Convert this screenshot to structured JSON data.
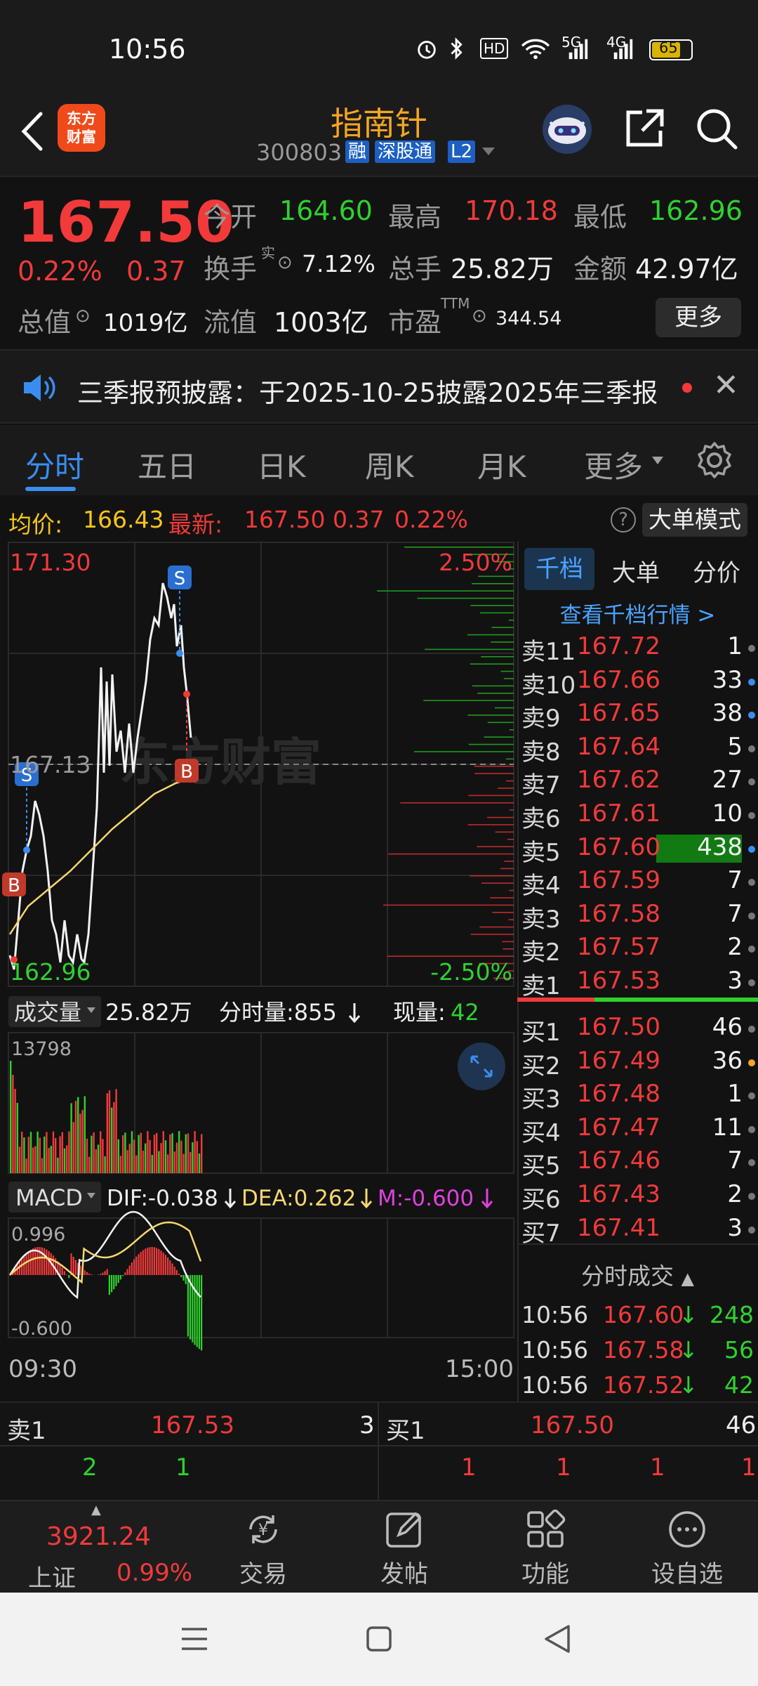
{
  "status_bar": {
    "time": "10:56",
    "battery": "65",
    "signal_5g": "5G",
    "signal_4g": "4G",
    "hd": "HD"
  },
  "header": {
    "logo_line1": "东方",
    "logo_line2": "财富",
    "stock_name": "指南针",
    "stock_code": "300803",
    "tags": [
      "融",
      "深股通",
      "L2"
    ]
  },
  "quote": {
    "price": "167.50",
    "change_pct": "0.22%",
    "change_amt": "0.37",
    "open_label": "今开",
    "open": "164.60",
    "high_label": "最高",
    "high": "170.18",
    "low_label": "最低",
    "low": "162.96",
    "turnover_label": "换手",
    "turnover_sup": "实",
    "turnover": "7.12%",
    "volume_label": "总手",
    "volume": "25.82万",
    "amount_label": "金额",
    "amount": "42.97亿",
    "mktcap_label": "总值",
    "mktcap": "1019亿",
    "float_label": "流值",
    "float": "1003亿",
    "pe_label": "市盈",
    "pe_sup": "TTM",
    "pe": "344.54",
    "more": "更多"
  },
  "notice": {
    "text": "三季报预披露：于2025-10-25披露2025年三季报"
  },
  "tabs": [
    "分时",
    "五日",
    "日K",
    "周K",
    "月K",
    "更多"
  ],
  "infobar": {
    "avg_label": "均价:",
    "avg": "166.43",
    "latest_label": "最新:",
    "latest": "167.50",
    "latest_chg": "0.37",
    "latest_pct": "0.22%",
    "big_order_btn": "大单模式"
  },
  "chart": {
    "price_top": "171.30",
    "price_mid": "167.13",
    "price_bottom": "162.96",
    "pct_top": "2.50%",
    "pct_bottom": "-2.50%",
    "watermark": "东方财富",
    "marker_s": "S",
    "marker_b": "B",
    "vol_selector": "成交量",
    "vol_total": "25.82万",
    "vol_tick_label": "分时量:855",
    "vol_now_label": "现量:",
    "vol_now": "42",
    "vol_max": "13798",
    "macd_selector": "MACD",
    "dif": "DIF:-0.038",
    "dea": "DEA:0.262",
    "m": "M:-0.600",
    "macd_top": "0.996",
    "macd_bottom": "-0.600",
    "time_start": "09:30",
    "time_end": "15:00"
  },
  "order_book": {
    "tabs": [
      "千档",
      "大单",
      "分价"
    ],
    "link": "查看千档行情 >",
    "asks": [
      {
        "label": "卖11",
        "price": "167.72",
        "vol": "1"
      },
      {
        "label": "卖10",
        "price": "167.66",
        "vol": "33"
      },
      {
        "label": "卖9",
        "price": "167.65",
        "vol": "38"
      },
      {
        "label": "卖8",
        "price": "167.64",
        "vol": "5"
      },
      {
        "label": "卖7",
        "price": "167.62",
        "vol": "27"
      },
      {
        "label": "卖6",
        "price": "167.61",
        "vol": "10"
      },
      {
        "label": "卖5",
        "price": "167.60",
        "vol": "438"
      },
      {
        "label": "卖4",
        "price": "167.59",
        "vol": "7"
      },
      {
        "label": "卖3",
        "price": "167.58",
        "vol": "7"
      },
      {
        "label": "卖2",
        "price": "167.57",
        "vol": "2"
      },
      {
        "label": "卖1",
        "price": "167.53",
        "vol": "3"
      }
    ],
    "bids": [
      {
        "label": "买1",
        "price": "167.50",
        "vol": "46"
      },
      {
        "label": "买2",
        "price": "167.49",
        "vol": "36"
      },
      {
        "label": "买3",
        "price": "167.48",
        "vol": "1"
      },
      {
        "label": "买4",
        "price": "167.47",
        "vol": "11"
      },
      {
        "label": "买5",
        "price": "167.46",
        "vol": "7"
      },
      {
        "label": "买6",
        "price": "167.43",
        "vol": "2"
      },
      {
        "label": "买7",
        "price": "167.41",
        "vol": "3"
      }
    ],
    "trades_header": "分时成交",
    "trades": [
      {
        "time": "10:56",
        "price": "167.60",
        "vol": "248"
      },
      {
        "time": "10:56",
        "price": "167.58",
        "vol": "56"
      },
      {
        "time": "10:56",
        "price": "167.52",
        "vol": "42"
      }
    ]
  },
  "bidask": {
    "ask_label": "卖1",
    "ask_price": "167.53",
    "ask_vol": "3",
    "bid_label": "买1",
    "bid_price": "167.50",
    "bid_vol": "46",
    "ask_queue": [
      "2",
      "1"
    ],
    "bid_queue": [
      "1",
      "1",
      "1",
      "1"
    ]
  },
  "bottom_nav": {
    "index_value": "3921.24",
    "index_name": "上证",
    "index_pct": "0.99%",
    "items": [
      "交易",
      "发帖",
      "功能",
      "设自选"
    ]
  },
  "colors": {
    "up": "#f23a3a",
    "down": "#2fd12f",
    "accent": "#3a8df0",
    "name": "#f5a623"
  }
}
